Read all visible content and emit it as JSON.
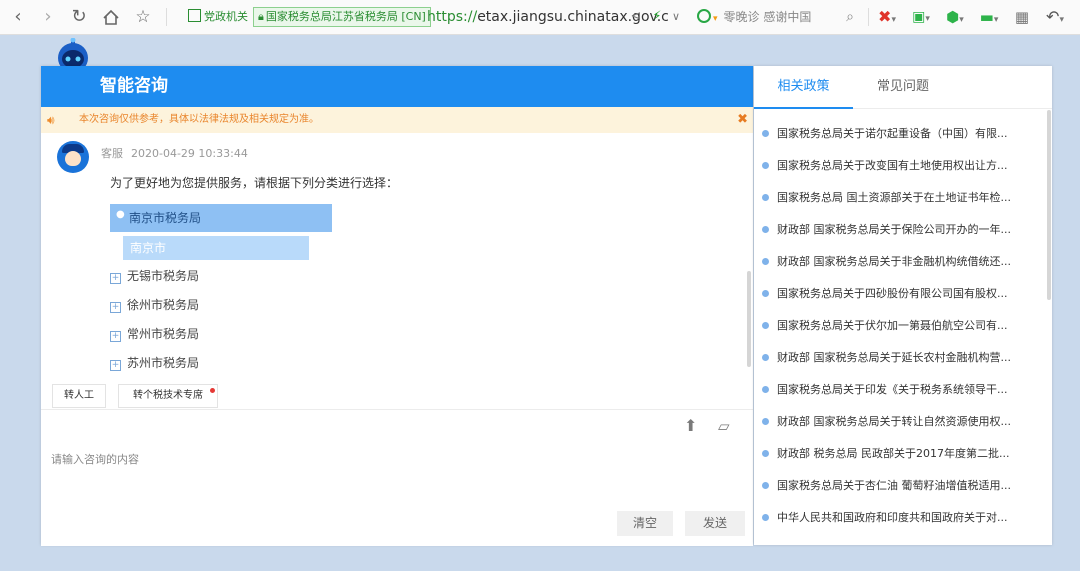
{
  "browser": {
    "badge_gov": "党政机关",
    "badge_site": "国家税务总局江苏省税务局 [CN]",
    "url_protocol": "https://",
    "url_host": "etax.jiangsu.chinatax.gov.c",
    "search_hint": "零晚诊 感谢中国",
    "icons": [
      "back-icon",
      "forward-icon",
      "reload-icon",
      "home-icon",
      "star-icon",
      "share-icon",
      "bolt-icon",
      "search-icon",
      "extension-icon",
      "grid-icon",
      "undo-icon"
    ]
  },
  "chat": {
    "title": "智能咨询",
    "notice": "本次咨询仅供参考，具体以法律法规及相关规定为准。",
    "message": {
      "sender": "客服",
      "time": "2020-04-29 10:33:44",
      "prompt": "为了更好地为您提供服务，请根据下列分类进行选择：",
      "selected": "南京市税务局",
      "selected_sub": "南京市",
      "options": [
        "无锡市税务局",
        "徐州市税务局",
        "常州市税务局",
        "苏州市税务局"
      ]
    },
    "btn_human": "转人工",
    "btn_tax": "转个税技术专席",
    "input_placeholder": "请输入咨询的内容",
    "btn_clear": "清空",
    "btn_send": "发送"
  },
  "side": {
    "tabs": [
      "相关政策",
      "常见问题"
    ],
    "policies": [
      "国家税务总局关于诺尔起重设备（中国）有限...",
      "国家税务总局关于改变国有土地使用权出让方...",
      "国家税务总局 国土资源部关于在土地证书年检...",
      "财政部 国家税务总局关于保险公司开办的一年...",
      "财政部 国家税务总局关于非金融机构统借统还...",
      "国家税务总局关于四砂股份有限公司国有股权...",
      "国家税务总局关于伏尔加一第聂伯航空公司有...",
      "财政部 国家税务总局关于延长农村金融机构营...",
      "国家税务总局关于印发《关于税务系统领导干...",
      "财政部 国家税务总局关于转让自然资源使用权...",
      "财政部 税务总局 民政部关于2017年度第二批...",
      "国家税务总局关于杏仁油 葡萄籽油增值税适用...",
      "中华人民共和国政府和印度共和国政府关于对..."
    ]
  },
  "colors": {
    "header_blue": "#1e8cf0",
    "notice_orange": "#e9852c",
    "selected_bg": "#8ec0f3"
  }
}
